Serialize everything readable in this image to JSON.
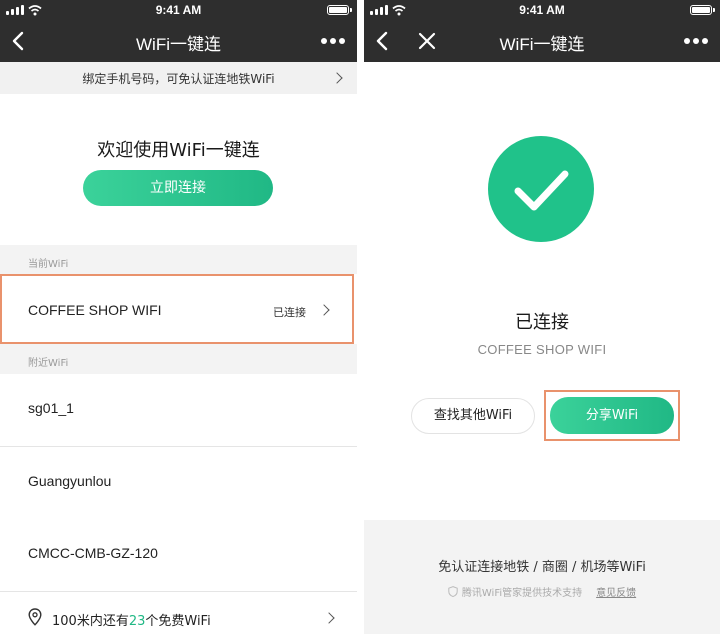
{
  "status_bar": {
    "time": "9:41 AM"
  },
  "left_screen": {
    "nav_title": "WiFi一键连",
    "bind_banner": "绑定手机号码，可免认证连地铁WiFi",
    "welcome_text": "欢迎使用WiFi一键连",
    "connect_button": "立即连接",
    "current_section_label": "当前WiFi",
    "current_wifi": {
      "name": "COFFEE SHOP WIFI",
      "status": "已连接"
    },
    "nearby_section_label": "附近WiFi",
    "nearby_networks": [
      {
        "name": "sg01_1"
      },
      {
        "name": "Guangyunlou"
      },
      {
        "name": "CMCC-CMB-GZ-120"
      }
    ],
    "free_wifi": {
      "prefix": "100米内还有",
      "count": "23",
      "suffix": "个免费WiFi"
    }
  },
  "right_screen": {
    "nav_title": "WiFi一键连",
    "connected_label": "已连接",
    "ssid": "COFFEE SHOP WIFI",
    "find_other_button": "查找其他WiFi",
    "share_button": "分享WiFi",
    "footer_slogan": "免认证连接地铁 / 商圈 / 机场等WiFi",
    "credit_text": "腾讯WiFi管家提供技术支持",
    "feedback_link": "意见反馈"
  },
  "colors": {
    "nav_background": "#2e2e2e",
    "accent_green": "#20b885",
    "highlight_border": "#e9926c"
  },
  "icons": [
    "back-icon",
    "close-icon",
    "more-icon",
    "chevron-right-icon",
    "checkmark-icon",
    "location-pin-icon",
    "shield-icon",
    "wifi-icon",
    "battery-icon",
    "signal-icon"
  ]
}
